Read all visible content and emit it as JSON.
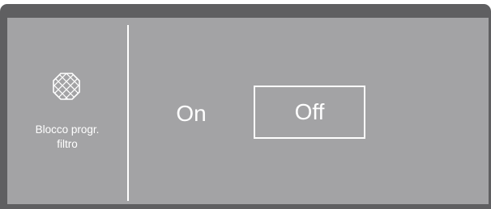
{
  "setting": {
    "icon": "filter-icon",
    "label_line1": "Blocco progr.",
    "label_line2": "filtro"
  },
  "options": {
    "on_label": "On",
    "off_label": "Off",
    "selected": "Off"
  },
  "colors": {
    "bezel": "#5f5f61",
    "screen": "#a3a3a5",
    "foreground": "#ffffff"
  }
}
